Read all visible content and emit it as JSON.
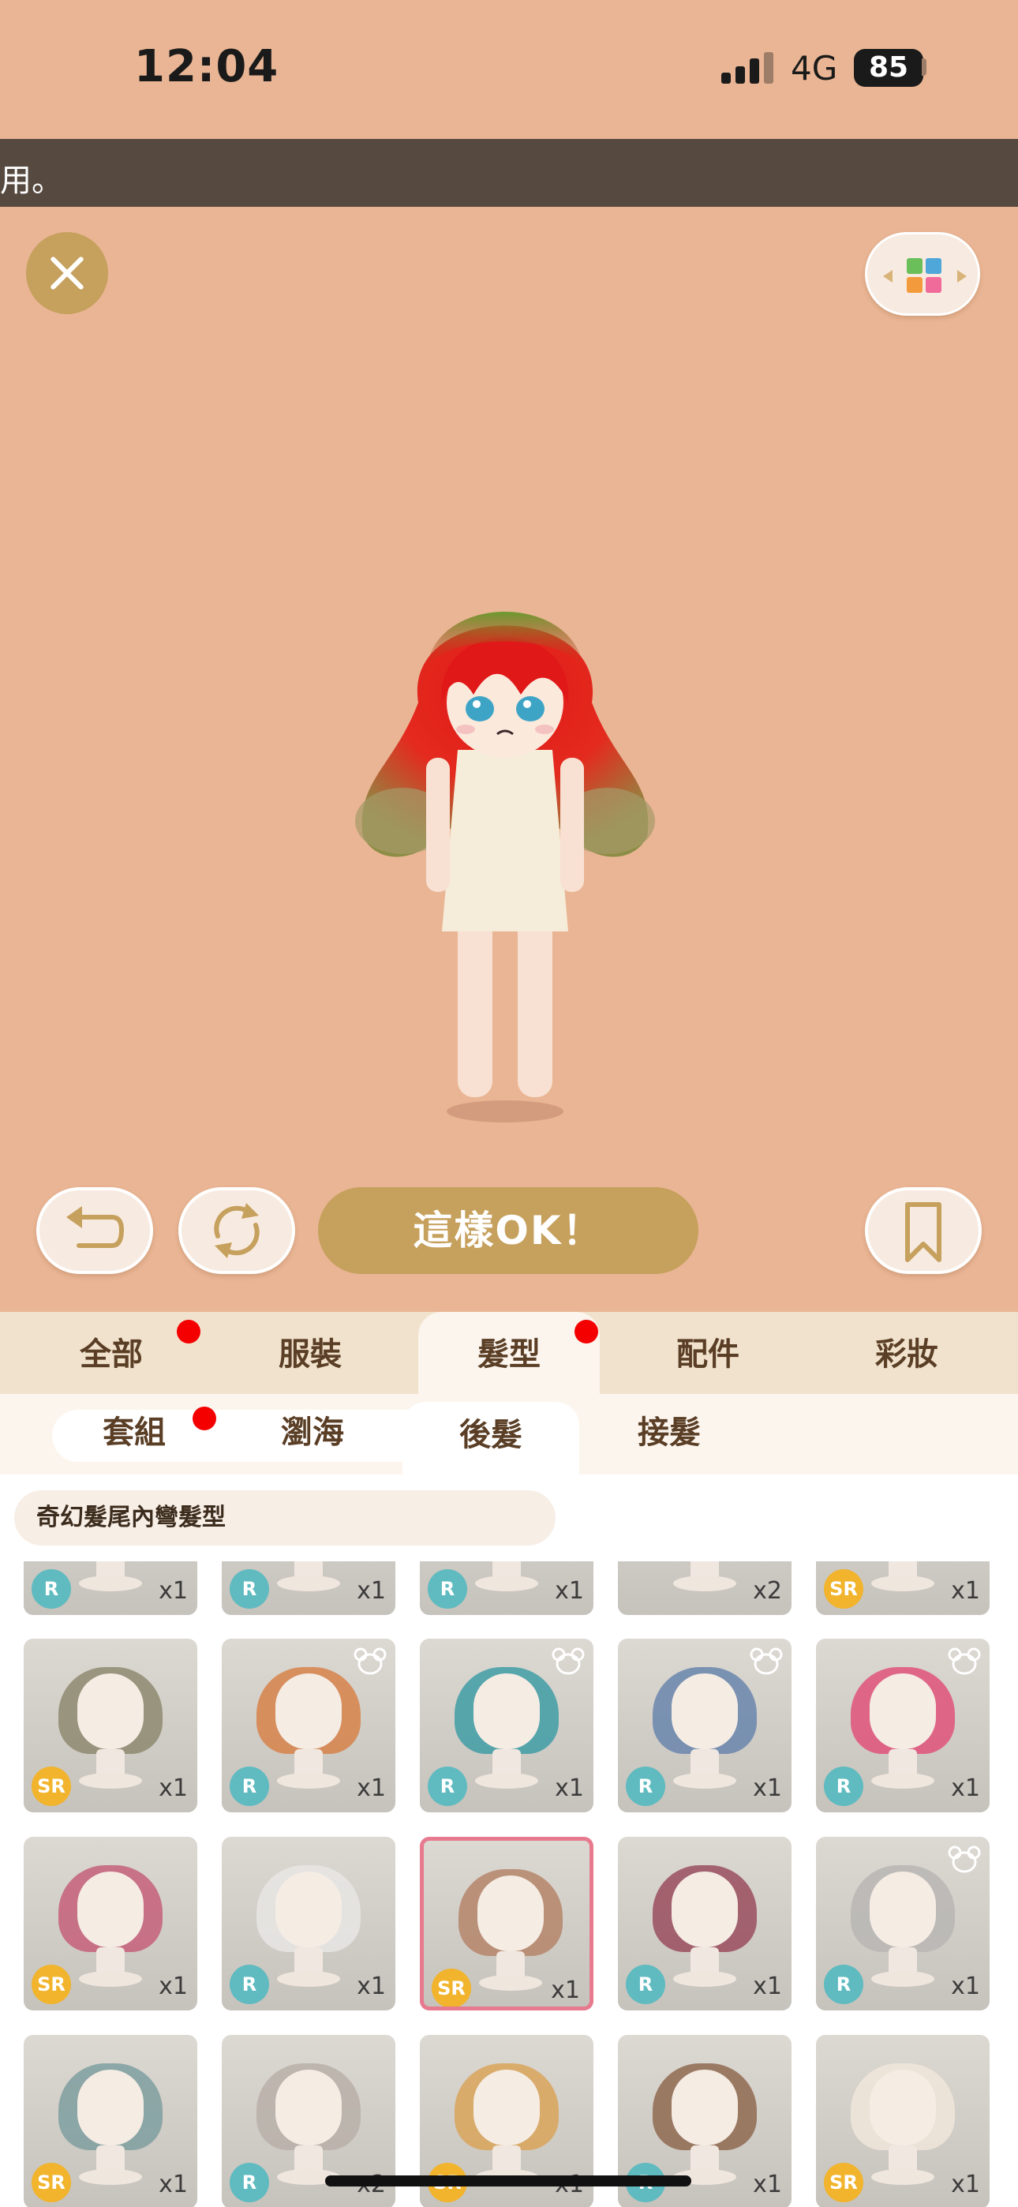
{
  "status_bar": {
    "time": "12:04",
    "network": "4G",
    "battery": "85"
  },
  "banner": {
    "text": "用。"
  },
  "stage": {
    "ok_label": "這樣OK！"
  },
  "category_tabs": [
    {
      "label": "全部",
      "badge": true
    },
    {
      "label": "服裝",
      "badge": false
    },
    {
      "label": "髮型",
      "badge": true,
      "active": true
    },
    {
      "label": "配件",
      "badge": false
    },
    {
      "label": "彩妝",
      "badge": false
    }
  ],
  "sub_tabs": [
    {
      "label": "套組",
      "badge": true
    },
    {
      "label": "瀏海",
      "badge": false
    },
    {
      "label": "後髮",
      "badge": false,
      "active": true
    },
    {
      "label": "接髮",
      "badge": false
    }
  ],
  "selected_item_name": "奇幻髮尾內彎髮型",
  "items": [
    {
      "rarity": "R",
      "count": "x1",
      "bear": false,
      "hair": "#3a3230"
    },
    {
      "rarity": "R",
      "count": "x1",
      "bear": false,
      "hair": "#5b7fa8"
    },
    {
      "rarity": "R",
      "count": "x1",
      "bear": false,
      "hair": "#d8d0c8"
    },
    {
      "rarity": "",
      "count": "x2",
      "bear": false,
      "hair": "#8a7a6a"
    },
    {
      "rarity": "SR",
      "count": "x1",
      "bear": false,
      "hair": "#ede5d8"
    },
    {
      "rarity": "SR",
      "count": "x1",
      "bear": false,
      "hair": "#8e8a70"
    },
    {
      "rarity": "R",
      "count": "x1",
      "bear": true,
      "hair": "#d7834a"
    },
    {
      "rarity": "R",
      "count": "x1",
      "bear": true,
      "hair": "#3f9ea6"
    },
    {
      "rarity": "R",
      "count": "x1",
      "bear": true,
      "hair": "#6a86ad"
    },
    {
      "rarity": "R",
      "count": "x1",
      "bear": true,
      "hair": "#e0527a"
    },
    {
      "rarity": "SR",
      "count": "x1",
      "bear": false,
      "hair": "#c5607a"
    },
    {
      "rarity": "R",
      "count": "x1",
      "bear": false,
      "hair": "#e8e6e4"
    },
    {
      "rarity": "SR",
      "count": "x1",
      "bear": false,
      "hair": "#b5856a",
      "selected": true
    },
    {
      "rarity": "R",
      "count": "x1",
      "bear": false,
      "hair": "#9a4e5e"
    },
    {
      "rarity": "R",
      "count": "x1",
      "bear": true,
      "hair": "#b9b6b4"
    },
    {
      "rarity": "SR",
      "count": "x1",
      "bear": false,
      "hair": "#7f9fa0"
    },
    {
      "rarity": "R",
      "count": "x2",
      "bear": false,
      "hair": "#b8b0a8"
    },
    {
      "rarity": "SR",
      "count": "x1",
      "bear": false,
      "hair": "#d9a45a"
    },
    {
      "rarity": "R",
      "count": "x1",
      "bear": false,
      "hair": "#8f6a50"
    },
    {
      "rarity": "SR",
      "count": "x1",
      "bear": false,
      "hair": "#f0e6da"
    }
  ],
  "colors": {
    "background": "#e9b594",
    "accent_gold": "#c6a05d",
    "banner": "#564940",
    "selected_border": "#e77a8e",
    "badge": "#f40000"
  }
}
